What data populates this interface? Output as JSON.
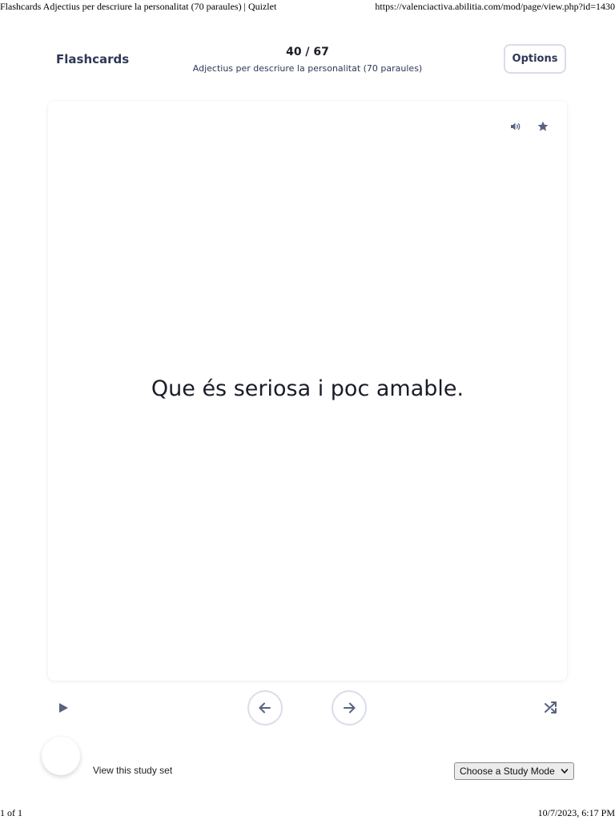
{
  "print_header": {
    "title": "Flashcards Adjectius per descriure la personalitat (70 paraules) | Quizlet",
    "url": "https://valenciactiva.abilitia.com/mod/page/view.php?id=1430"
  },
  "topbar": {
    "brand": "Flashcards",
    "progress": "40 / 67",
    "set_title": "Adjectius per descriure la personalitat (70 paraules)",
    "options_label": "Options"
  },
  "card": {
    "term": "Que és seriosa i poc amable.",
    "audio_icon": "speaker-icon",
    "star_icon": "star-icon"
  },
  "controls": {
    "play_icon": "play-icon",
    "prev_icon": "arrow-left-icon",
    "next_icon": "arrow-right-icon",
    "shuffle_icon": "shuffle-icon"
  },
  "bottom": {
    "study_link": "View this study set",
    "mode_select_value": "Choose a Study Mode"
  },
  "print_footer": {
    "pages": "1 of 1",
    "datetime": "10/7/2023, 6:17 PM"
  },
  "colors": {
    "primary_text": "#2e3856",
    "border": "#d9dde8",
    "icon": "#586380"
  }
}
